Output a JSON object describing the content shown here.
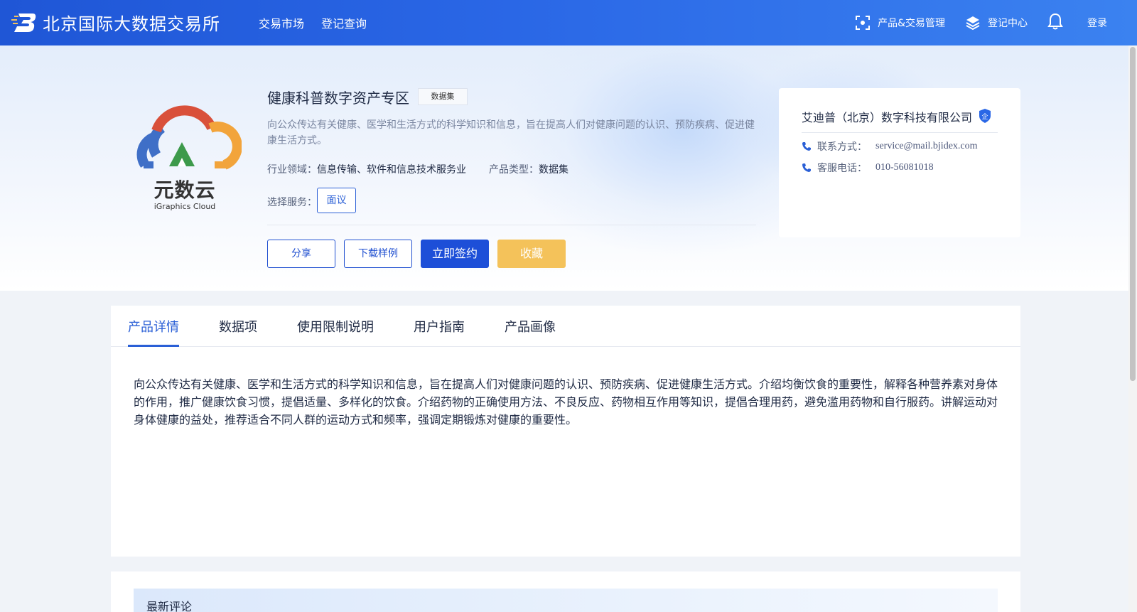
{
  "header": {
    "site_title": "北京国际大数据交易所",
    "nav": [
      "交易市场",
      "登记查询"
    ],
    "product_mgmt": "产品&交易管理",
    "registry_center": "登记中心",
    "login": "登录",
    "icons": {
      "logo": "bjidex-logo-icon",
      "product_mgmt": "scan-focus-icon",
      "registry": "layers-icon",
      "bell": "bell-icon"
    }
  },
  "product": {
    "logo_cn": "元数云",
    "logo_en": "iGraphics Cloud",
    "title": "健康科普数字资产专区",
    "badge": "数据集",
    "description": "向公众传达有关健康、医学和生活方式的科学知识和信息，旨在提高人们对健康问题的认识、预防疾病、促进健康生活方式。",
    "industry_label": "行业领域：",
    "industry_value": "信息传输、软件和信息技术服务业",
    "type_label": "产品类型：",
    "type_value": "数据集",
    "service_label": "选择服务：",
    "service_option": "面议",
    "buttons": {
      "share": "分享",
      "download_sample": "下载样例",
      "sign_now": "立即签约",
      "favorite": "收藏"
    }
  },
  "company": {
    "name": "艾迪普（北京）数字科技有限公司",
    "shield_badge": "企",
    "contact_label": "联系方式：",
    "contact_value": "service@mail.bjidex.com",
    "phone_label": "客服电话：",
    "phone_value": "010-56081018"
  },
  "tabs": {
    "items": [
      "产品详情",
      "数据项",
      "使用限制说明",
      "用户指南",
      "产品画像"
    ],
    "active": "产品详情"
  },
  "detail": {
    "text": "向公众传达有关健康、医学和生活方式的科学知识和信息，旨在提高人们对健康问题的认识、预防疾病、促进健康生活方式。介绍均衡饮食的重要性，解释各种营养素对身体的作用，推广健康饮食习惯，提倡适量、多样化的饮食。介绍药物的正确使用方法、不良反应、药物相互作用等知识，提倡合理用药，避免滥用药物和自行服药。讲解运动对身体健康的益处，推荐适合不同人群的运动方式和频率，强调定期锻炼对健康的重要性。"
  },
  "comments": {
    "title": "最新评论"
  },
  "colors": {
    "primary": "#1d4fd8",
    "gold": "#f4c25a",
    "header_start": "#1f56d6",
    "header_end": "#3b82f0"
  }
}
